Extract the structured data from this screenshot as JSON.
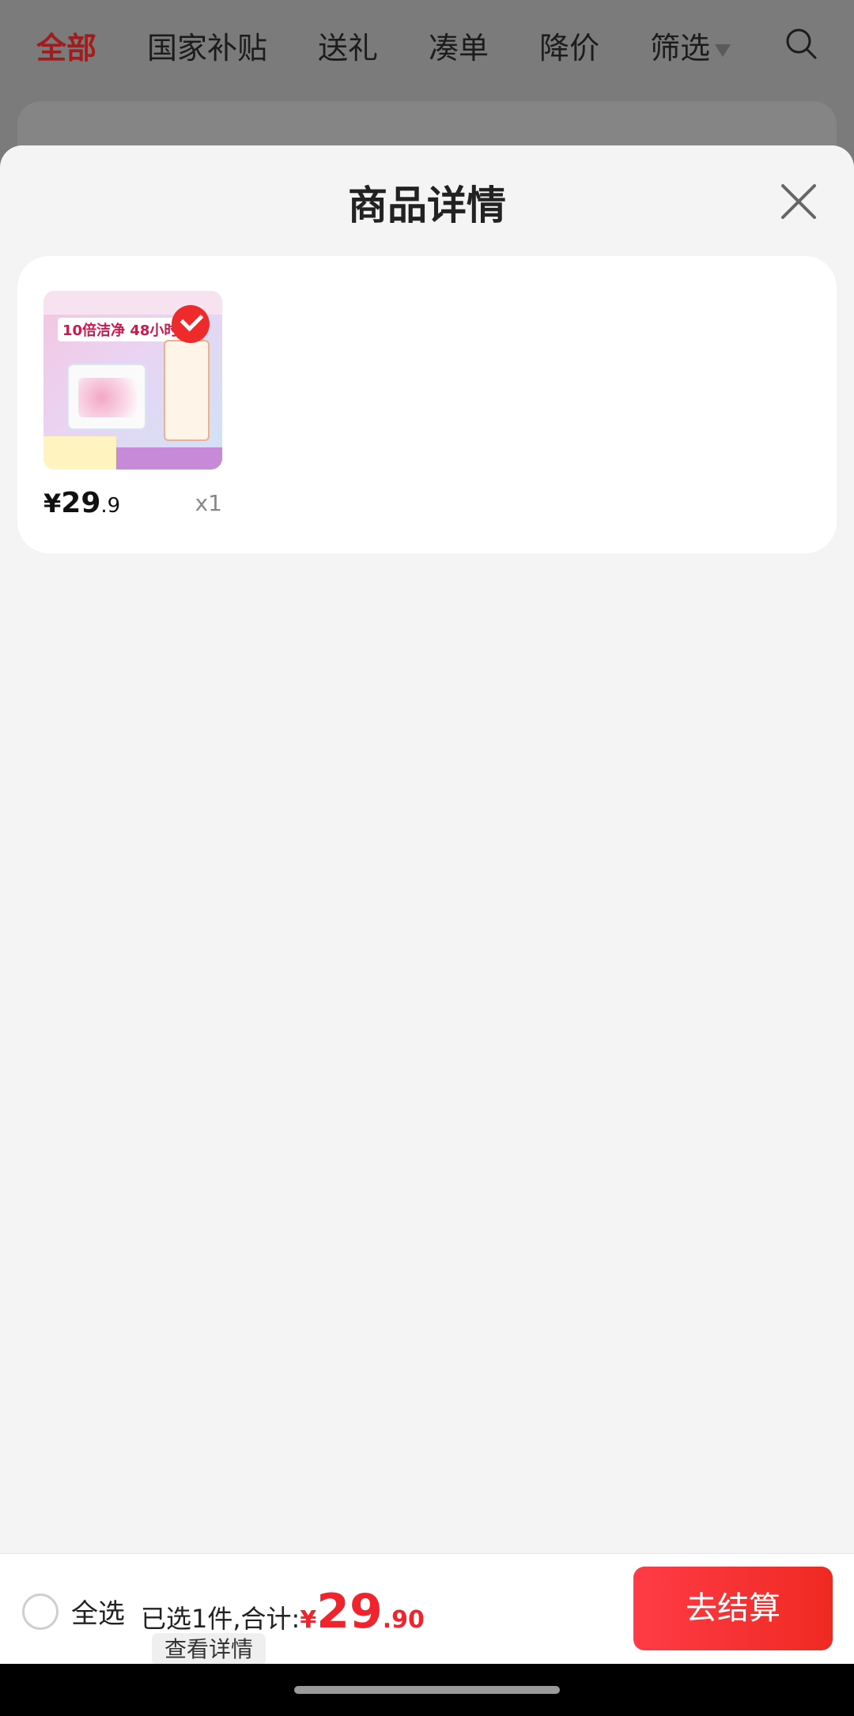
{
  "tabs": [
    {
      "label": "全部",
      "active": true
    },
    {
      "label": "国家补贴",
      "active": false
    },
    {
      "label": "送礼",
      "active": false
    },
    {
      "label": "凑单",
      "active": false
    },
    {
      "label": "降价",
      "active": false
    },
    {
      "label": "筛选",
      "active": false
    }
  ],
  "sheet": {
    "title": "商品详情"
  },
  "product": {
    "image_headline": "10倍洁净 48小时",
    "price_currency": "¥",
    "price_int": "29",
    "price_dec": ".9",
    "quantity": "x1",
    "selected": true
  },
  "bottom_bar": {
    "select_all_label": "全选",
    "summary_label": "已选1件,合计:",
    "total_currency": "¥",
    "total_int": "29",
    "total_dec": ".90",
    "details_label": "查看详情",
    "checkout_label": "去结算"
  },
  "colors": {
    "accent_red": "#f1242e",
    "active_tab": "#a11d1d"
  }
}
